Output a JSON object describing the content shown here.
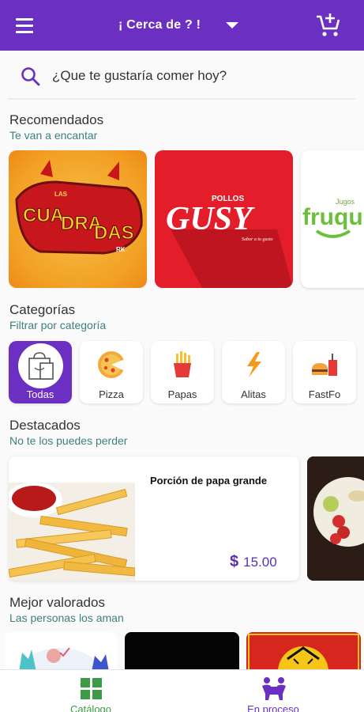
{
  "topbar": {
    "location_label": "¡ Cerca de ? !"
  },
  "search": {
    "placeholder": "¿Que te gustaría comer hoy?"
  },
  "recommended": {
    "title": "Recomendados",
    "subtitle": "Te van a encantar",
    "cards": [
      {
        "logo_lines": [
          "LAS",
          "CUA",
          "DRA",
          "DAS",
          "RK"
        ]
      },
      {
        "logo_top": "POLLOS",
        "logo_main": "GUSY",
        "logo_tag": "Sabor a tu gusto"
      },
      {
        "logo_main": "fruqu",
        "logo_top": "Jugos"
      }
    ]
  },
  "categories": {
    "title": "Categorías",
    "subtitle": "Filtrar por categoría",
    "items": [
      {
        "label": "Todas"
      },
      {
        "label": "Pizza"
      },
      {
        "label": "Papas"
      },
      {
        "label": "Alitas"
      },
      {
        "label": "FastFo"
      }
    ]
  },
  "featured": {
    "title": "Destacados",
    "subtitle": "No te los puedes perder",
    "items": [
      {
        "name": "Porción de papa grande",
        "currency": "$",
        "price": "15.00"
      }
    ]
  },
  "top_rated": {
    "title": "Mejor valorados",
    "subtitle": "Las personas los aman"
  },
  "bottom_nav": {
    "items": [
      {
        "label": "Catálogo",
        "icon": "grid-icon"
      },
      {
        "label": "En proceso",
        "icon": "delivery-icon"
      }
    ]
  },
  "colors": {
    "primary": "#6b2fc2",
    "accent_green": "#3d9a46",
    "subtitle_teal": "#3f7f7f"
  }
}
